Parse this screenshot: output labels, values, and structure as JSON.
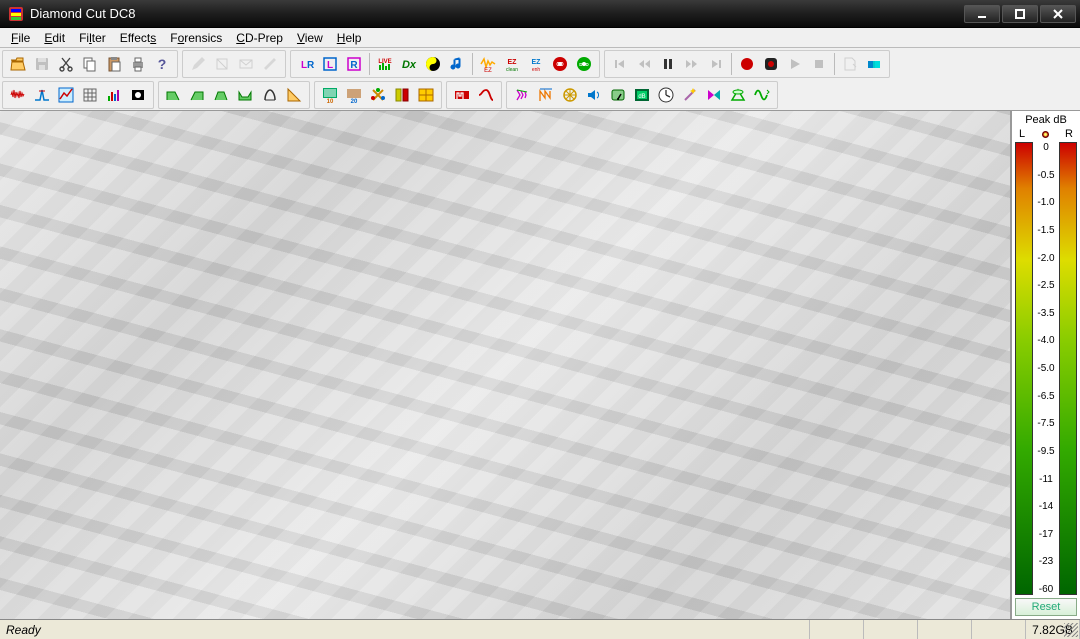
{
  "window": {
    "title": "Diamond Cut DC8"
  },
  "menu": {
    "items": [
      {
        "label": "File",
        "u": "F"
      },
      {
        "label": "Edit",
        "u": "E"
      },
      {
        "label": "Filter",
        "u": "F"
      },
      {
        "label": "Effects",
        "u": "E"
      },
      {
        "label": "Forensics",
        "u": "F"
      },
      {
        "label": "CD-Prep",
        "u": "C"
      },
      {
        "label": "View",
        "u": "V"
      },
      {
        "label": "Help",
        "u": "H"
      }
    ]
  },
  "toolbar1": {
    "g1": [
      "open",
      "save",
      "cut",
      "copy",
      "paste",
      "print",
      "help"
    ],
    "g2": [
      "pen",
      "fill",
      "env",
      "knife"
    ],
    "g3": [
      "LR",
      "L",
      "R",
      "live",
      "dx",
      "cd-yinyang",
      "notes",
      "ezi",
      "ezc",
      "eze",
      "cd-red",
      "dvd"
    ],
    "g4": [
      "prev",
      "rew",
      "pause",
      "ff",
      "next",
      "rec-start",
      "rec-stop",
      "play",
      "stop",
      "marker",
      "hue"
    ]
  },
  "toolbar2": {
    "g1": [
      "noise",
      "spike",
      "spec",
      "grid",
      "levels",
      "lpf"
    ],
    "g2": [
      "fr1",
      "fr2",
      "fr3",
      "fr4",
      "comp",
      "angle"
    ],
    "g3": [
      "e10",
      "e20",
      "jitter",
      "ch",
      "bal"
    ],
    "g4": [
      "gate",
      "slope"
    ],
    "g5": [
      "fx1",
      "fx2",
      "fx3",
      "spk",
      "gauge",
      "clip",
      "clock",
      "wand",
      "xfade",
      "env",
      "sine"
    ]
  },
  "meter": {
    "title": "Peak dB",
    "l_label": "L",
    "r_label": "R",
    "ticks": [
      "0",
      "-0.5",
      "-1.0",
      "-1.5",
      "-2.0",
      "-2.5",
      "-3.5",
      "-4.0",
      "-5.0",
      "-6.5",
      "-7.5",
      "-9.5",
      "-11",
      "-14",
      "-17",
      "-23",
      "-60"
    ],
    "reset": "Reset"
  },
  "status": {
    "ready": "Ready",
    "disk": "7.82GB"
  }
}
